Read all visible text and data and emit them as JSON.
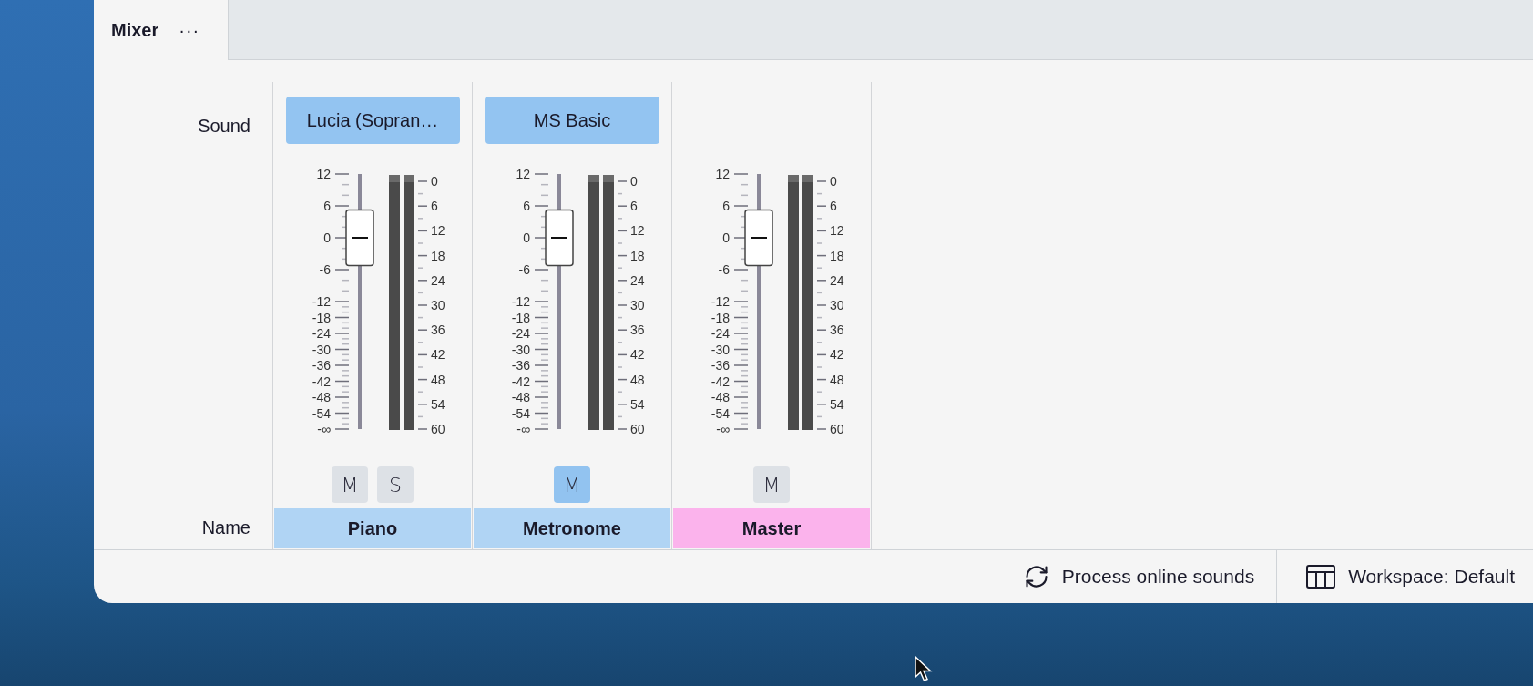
{
  "tab": {
    "label": "Mixer",
    "more": "···"
  },
  "row_labels": {
    "sound": "Sound",
    "name": "Name"
  },
  "channels": [
    {
      "sound": "Lucia (Sopran…",
      "name": "Piano",
      "color": "#b0d4f4",
      "level": 0.75,
      "fader_ticks": [
        "12",
        "6",
        "0",
        "-6",
        "-12",
        "-18",
        "-24",
        "-30",
        "-36",
        "-42",
        "-48",
        "-54",
        "-∞"
      ],
      "meter_ticks": [
        "0",
        "6",
        "12",
        "18",
        "24",
        "30",
        "36",
        "42",
        "48",
        "54",
        "60"
      ],
      "buttons": [
        {
          "label": "M",
          "on": false
        },
        {
          "label": "S",
          "on": false
        }
      ]
    },
    {
      "sound": "MS Basic",
      "name": "Metronome",
      "color": "#b0d4f4",
      "level": 0.75,
      "fader_ticks": [
        "12",
        "6",
        "0",
        "-6",
        "-12",
        "-18",
        "-24",
        "-30",
        "-36",
        "-42",
        "-48",
        "-54",
        "-∞"
      ],
      "meter_ticks": [
        "0",
        "6",
        "12",
        "18",
        "24",
        "30",
        "36",
        "42",
        "48",
        "54",
        "60"
      ],
      "buttons": [
        {
          "label": "M",
          "on": true
        }
      ]
    },
    {
      "name": "Master",
      "color": "#fbb3ec",
      "level": 0.75,
      "fader_ticks": [
        "12",
        "6",
        "0",
        "-6",
        "-12",
        "-18",
        "-24",
        "-30",
        "-36",
        "-42",
        "-48",
        "-54",
        "-∞"
      ],
      "meter_ticks": [
        "0",
        "6",
        "12",
        "18",
        "24",
        "30",
        "36",
        "42",
        "48",
        "54",
        "60"
      ],
      "buttons": [
        {
          "label": "M",
          "on": false
        }
      ]
    }
  ],
  "status_bar": [
    {
      "kind": "sync",
      "label": "Process online sounds"
    },
    {
      "kind": "workspace",
      "label": "Workspace: Default"
    }
  ]
}
